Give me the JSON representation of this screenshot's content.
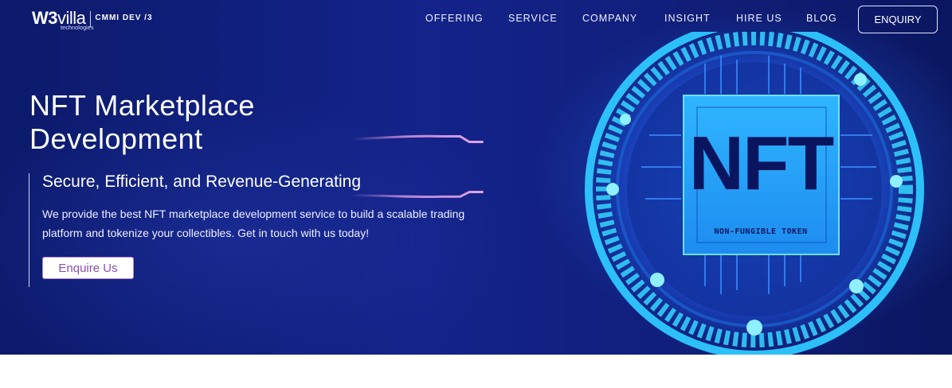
{
  "brand": {
    "logo_main": "W3",
    "logo_villa": "villa",
    "logo_sub": "technologies",
    "cmmi": "CMMI DEV /3"
  },
  "nav": {
    "items": [
      {
        "label": "OFFERING"
      },
      {
        "label": "SERVICE"
      },
      {
        "label": "COMPANY"
      },
      {
        "label": "INSIGHT"
      },
      {
        "label": "HIRE US"
      },
      {
        "label": "BLOG"
      }
    ],
    "enquiry_label": "ENQUIRY"
  },
  "hero": {
    "title_line1": "NFT Marketplace",
    "title_line2": "Development",
    "subtitle": "Secure, Efficient, and Revenue-Generating",
    "description": "We provide the best NFT marketplace development service to build a scalable trading platform and tokenize your collectibles. Get in touch with us today!",
    "cta_label": "Enquire Us"
  },
  "illustration": {
    "chip_text": "NFT",
    "chip_subtext": "NON-FUNGIBLE TOKEN",
    "icon": "nft-coin-icon"
  },
  "colors": {
    "hero_bg": "#13238a",
    "accent_cyan": "#3fd0ff",
    "streak_pink": "#c98bd8",
    "cta_text": "#8a4fb8"
  }
}
